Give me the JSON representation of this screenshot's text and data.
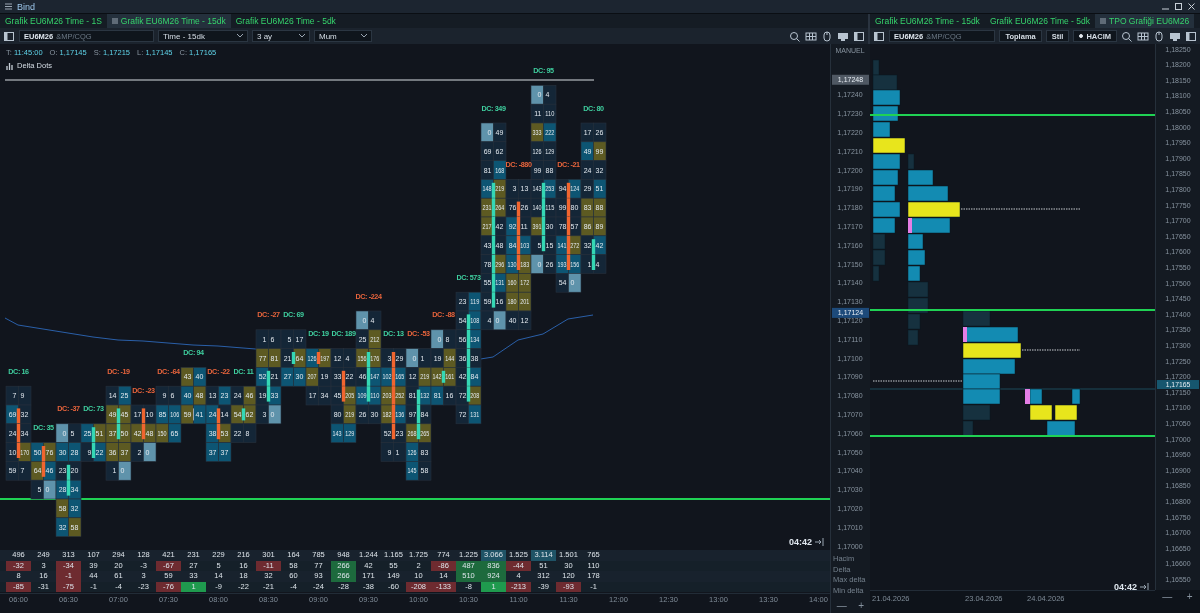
{
  "window": {
    "title": "Bind"
  },
  "left_panel": {
    "tabs": [
      {
        "label": "Grafik EU6M26 Time - 1S",
        "selected": false
      },
      {
        "label": "Grafik EU6M26 Time - 15dk",
        "selected": true
      },
      {
        "label": "Grafik EU6M26 Time - 5dk",
        "selected": false
      }
    ],
    "symbol": {
      "name": "EU6M26",
      "source": "&MP/CQG"
    },
    "dropdowns": [
      "Time - 15dk",
      "3 ay",
      "Mum"
    ],
    "ohlc": [
      {
        "label": "T:",
        "value": "11:45:00"
      },
      {
        "label": "O:",
        "value": "1,17145"
      },
      {
        "label": "S:",
        "value": "1,17215"
      },
      {
        "label": "L:",
        "value": "1,17145"
      },
      {
        "label": "C:",
        "value": "1,17165"
      }
    ],
    "indicator": "Delta Dots",
    "countdown": "04:42",
    "candles": [
      {
        "dc": "DC: 16",
        "color": "#3fcf9f",
        "kind": "down",
        "rows": [
          null,
          null,
          null,
          null,
          null,
          null,
          null,
          null,
          null,
          null,
          null,
          null,
          null,
          null,
          null,
          null,
          null,
          [
            "7",
            "9",
            false
          ],
          [
            "69",
            "32",
            true
          ],
          [
            "24",
            "34",
            true
          ],
          [
            "10",
            "170",
            true
          ],
          [
            "59",
            "7",
            false
          ]
        ]
      },
      {
        "dc": "DC: 35",
        "color": "#3fcf9f",
        "kind": "down",
        "rows": [
          null,
          null,
          null,
          null,
          null,
          null,
          null,
          null,
          null,
          null,
          null,
          null,
          null,
          null,
          null,
          null,
          null,
          null,
          null,
          null,
          [
            "50",
            "76",
            true
          ],
          [
            "64",
            "46",
            true
          ],
          [
            "5",
            "0",
            false
          ]
        ]
      },
      {
        "dc": "DC: -37",
        "color": "#e8643c",
        "kind": "up",
        "rows": [
          null,
          null,
          null,
          null,
          null,
          null,
          null,
          null,
          null,
          null,
          null,
          null,
          null,
          null,
          null,
          null,
          null,
          null,
          null,
          [
            "0",
            "5",
            false
          ],
          [
            "30",
            "28",
            false
          ],
          [
            "23",
            "20",
            true
          ],
          [
            "28",
            "34",
            true
          ],
          [
            "58",
            "32",
            false
          ],
          [
            "32",
            "58",
            false
          ]
        ]
      },
      {
        "dc": "DC: 73",
        "color": "#3fcf9f",
        "kind": "up",
        "rows": [
          null,
          null,
          null,
          null,
          null,
          null,
          null,
          null,
          null,
          null,
          null,
          null,
          null,
          null,
          null,
          null,
          null,
          null,
          null,
          [
            "25",
            "51",
            true
          ],
          [
            "9",
            "22",
            true
          ]
        ]
      },
      {
        "dc": "DC: -19",
        "color": "#e8643c",
        "kind": "up",
        "rows": [
          null,
          null,
          null,
          null,
          null,
          null,
          null,
          null,
          null,
          null,
          null,
          null,
          null,
          null,
          null,
          null,
          null,
          [
            "14",
            "25",
            false
          ],
          [
            "49",
            "45",
            true
          ],
          [
            "37",
            "50",
            true
          ],
          [
            "36",
            "37",
            false
          ],
          [
            "1",
            "0",
            false
          ]
        ]
      },
      {
        "dc": "DC: -23",
        "color": "#e8643c",
        "kind": "down",
        "rows": [
          null,
          null,
          null,
          null,
          null,
          null,
          null,
          null,
          null,
          null,
          null,
          null,
          null,
          null,
          null,
          null,
          null,
          null,
          [
            "17",
            "10",
            true
          ],
          [
            "42",
            "48",
            true
          ],
          [
            "2",
            "0",
            false
          ]
        ]
      },
      {
        "dc": "DC: -64",
        "color": "#e8643c",
        "rows": [
          null,
          null,
          null,
          null,
          null,
          null,
          null,
          null,
          null,
          null,
          null,
          null,
          null,
          null,
          null,
          null,
          null,
          [
            "9",
            "6",
            false
          ],
          [
            "85",
            "106",
            false
          ],
          [
            "150",
            "65",
            false
          ]
        ]
      },
      {
        "dc": "DC: 94",
        "color": "#3fcf9f",
        "kind": "doji",
        "rows": [
          null,
          null,
          null,
          null,
          null,
          null,
          null,
          null,
          null,
          null,
          null,
          null,
          null,
          null,
          null,
          null,
          [
            "43",
            "40",
            false
          ],
          [
            "40",
            "48",
            false
          ],
          [
            "59",
            "41",
            true
          ]
        ]
      },
      {
        "dc": "DC: -22",
        "color": "#e8643c",
        "kind": "down",
        "rows": [
          null,
          null,
          null,
          null,
          null,
          null,
          null,
          null,
          null,
          null,
          null,
          null,
          null,
          null,
          null,
          null,
          null,
          [
            "13",
            "23",
            false
          ],
          [
            "24",
            "14",
            true
          ],
          [
            "38",
            "53",
            true
          ],
          [
            "37",
            "37",
            false
          ]
        ]
      },
      {
        "dc": "DC: 11",
        "color": "#3fcf9f",
        "kind": "up",
        "rows": [
          null,
          null,
          null,
          null,
          null,
          null,
          null,
          null,
          null,
          null,
          null,
          null,
          null,
          null,
          null,
          null,
          null,
          [
            "24",
            "46",
            false
          ],
          [
            "54",
            "62",
            true
          ],
          [
            "22",
            "8",
            false
          ]
        ]
      },
      {
        "dc": "DC: -27",
        "color": "#e8643c",
        "kind": "up",
        "rows": [
          null,
          null,
          null,
          null,
          null,
          null,
          null,
          null,
          null,
          null,
          null,
          null,
          null,
          null,
          [
            "1",
            "6",
            false
          ],
          [
            "77",
            "81",
            false
          ],
          [
            "52",
            "21",
            true
          ],
          [
            "19",
            "33",
            true
          ],
          [
            "3",
            "0",
            false
          ]
        ]
      },
      {
        "dc": "DC: 69",
        "color": "#3fcf9f",
        "kind": "up",
        "rows": [
          null,
          null,
          null,
          null,
          null,
          null,
          null,
          null,
          null,
          null,
          null,
          null,
          null,
          null,
          [
            "5",
            "17",
            false
          ],
          [
            "21",
            "64",
            true
          ],
          [
            "27",
            "30",
            false
          ]
        ]
      },
      {
        "dc": "DC: 19",
        "color": "#3fcf9f",
        "kind": "down",
        "rows": [
          null,
          null,
          null,
          null,
          null,
          null,
          null,
          null,
          null,
          null,
          null,
          null,
          null,
          null,
          null,
          [
            "126",
            "197",
            true
          ],
          [
            "207",
            "19",
            false
          ],
          [
            "17",
            "34",
            false
          ]
        ]
      },
      {
        "dc": "DC: 189",
        "color": "#3fcf9f",
        "kind": "down",
        "rows": [
          null,
          null,
          null,
          null,
          null,
          null,
          null,
          null,
          null,
          null,
          null,
          null,
          null,
          null,
          null,
          [
            "12",
            "4",
            false
          ],
          [
            "33",
            "22",
            true
          ],
          [
            "45",
            "205",
            true
          ],
          [
            "80",
            "219",
            false
          ],
          [
            "143",
            "129",
            false
          ]
        ]
      },
      {
        "dc": "DC: -224",
        "color": "#e8643c",
        "kind": "up",
        "rows": [
          null,
          null,
          null,
          null,
          null,
          null,
          null,
          null,
          null,
          null,
          null,
          null,
          null,
          [
            "0",
            "4",
            false
          ],
          [
            "25",
            "212",
            false
          ],
          [
            "156",
            "176",
            true
          ],
          [
            "46",
            "147",
            true
          ],
          [
            "109",
            "110",
            true
          ],
          [
            "26",
            "30",
            false
          ]
        ]
      },
      {
        "dc": "DC: 13",
        "color": "#3fcf9f",
        "kind": "down",
        "rows": [
          null,
          null,
          null,
          null,
          null,
          null,
          null,
          null,
          null,
          null,
          null,
          null,
          null,
          null,
          null,
          [
            "3",
            "29",
            true
          ],
          [
            "102",
            "165",
            true
          ],
          [
            "203",
            "252",
            true
          ],
          [
            "182",
            "136",
            true
          ],
          [
            "52",
            "23",
            true
          ],
          [
            "9",
            "1",
            false
          ]
        ]
      },
      {
        "dc": "DC: -53",
        "color": "#e8643c",
        "kind": "up",
        "rows": [
          null,
          null,
          null,
          null,
          null,
          null,
          null,
          null,
          null,
          null,
          null,
          null,
          null,
          null,
          null,
          [
            "0",
            "1",
            false
          ],
          [
            "12",
            "219",
            false
          ],
          [
            "81",
            "132",
            true
          ],
          [
            "97",
            "84",
            true
          ],
          [
            "268",
            "265",
            true
          ],
          [
            "126",
            "83",
            false
          ],
          [
            "145",
            "58",
            false
          ]
        ]
      },
      {
        "dc": "DC: -88",
        "color": "#e8643c",
        "kind": "up",
        "rows": [
          null,
          null,
          null,
          null,
          null,
          null,
          null,
          null,
          null,
          null,
          null,
          null,
          null,
          null,
          [
            "0",
            "8",
            false
          ],
          [
            "19",
            "144",
            false
          ],
          [
            "142",
            "161",
            true
          ],
          [
            "81",
            "16",
            false
          ]
        ]
      },
      {
        "dc": "DC: 573",
        "color": "#3fcf9f",
        "kind": "up",
        "rows": [
          null,
          null,
          null,
          null,
          null,
          null,
          null,
          null,
          null,
          null,
          null,
          null,
          [
            "23",
            "119",
            false
          ],
          [
            "54",
            "108",
            true
          ],
          [
            "56",
            "134",
            true
          ],
          [
            "36",
            "38",
            true
          ],
          [
            "42",
            "84",
            true
          ],
          [
            "72",
            "208",
            true
          ],
          [
            "72",
            "131",
            false
          ]
        ]
      },
      {
        "dc": "DC: 349",
        "color": "#3fcf9f",
        "kind": "up",
        "rows": [
          null,
          null,
          null,
          [
            "0",
            "49",
            false
          ],
          [
            "69",
            "62",
            false
          ],
          [
            "81",
            "168",
            false
          ],
          [
            "148",
            "219",
            true
          ],
          [
            "231",
            "264",
            true
          ],
          [
            "217",
            "42",
            true
          ],
          [
            "43",
            "48",
            true
          ],
          [
            "78",
            "296",
            true
          ],
          [
            "55",
            "131",
            true
          ],
          [
            "59",
            "16",
            true
          ],
          [
            "4",
            "0",
            false
          ]
        ]
      },
      {
        "dc": "DC: -880",
        "color": "#e8643c",
        "kind": "down",
        "rows": [
          null,
          null,
          null,
          null,
          null,
          null,
          [
            "3",
            "13",
            false
          ],
          [
            "76",
            "26",
            true
          ],
          [
            "92",
            "11",
            true
          ],
          [
            "84",
            "103",
            true
          ],
          [
            "130",
            "183",
            true
          ],
          [
            "160",
            "172",
            false
          ],
          [
            "180",
            "201",
            false
          ],
          [
            "40",
            "12",
            false
          ]
        ]
      },
      {
        "dc": "DC: 95",
        "color": "#3fcf9f",
        "kind": "up",
        "rows": [
          null,
          [
            "0",
            "4",
            false
          ],
          [
            "11",
            "110",
            false
          ],
          [
            "333",
            "222",
            false
          ],
          [
            "126",
            "129",
            false
          ],
          [
            "99",
            "88",
            false
          ],
          [
            "143",
            "253",
            true
          ],
          [
            "140",
            "115",
            true
          ],
          [
            "391",
            "30",
            true
          ],
          [
            "5",
            "15",
            true
          ],
          [
            "0",
            "26",
            false
          ]
        ]
      },
      {
        "dc": "DC: -21",
        "color": "#e8643c",
        "kind": "down",
        "rows": [
          null,
          null,
          null,
          null,
          null,
          null,
          [
            "94",
            "124",
            true
          ],
          [
            "99",
            "80",
            true
          ],
          [
            "78",
            "57",
            true
          ],
          [
            "141",
            "272",
            true
          ],
          [
            "193",
            "156",
            true
          ],
          [
            "54",
            "0",
            false
          ]
        ]
      },
      {
        "dc": "DC: 80",
        "color": "#3fcf9f",
        "kind": "up",
        "rows": [
          null,
          null,
          null,
          [
            "17",
            "26",
            false
          ],
          [
            "49",
            "99",
            false
          ],
          [
            "24",
            "32",
            false
          ],
          [
            "29",
            "51",
            false
          ],
          [
            "83",
            "88",
            false
          ],
          [
            "86",
            "89",
            false
          ],
          [
            "32",
            "42",
            true
          ],
          [
            "1",
            "4",
            true
          ]
        ]
      }
    ],
    "price_axis": {
      "mode": "MANUEL",
      "labels": [
        "1,17240",
        "1,17230",
        "1,17220",
        "1,17210",
        "1,17200",
        "1,17190",
        "1,17180",
        "1,17170",
        "1,17160",
        "1,17150",
        "1,17140",
        "1,17130",
        "1,17120",
        "1,17110",
        "1,17100",
        "1,17090",
        "1,17080",
        "1,17070",
        "1,17060",
        "1,17050",
        "1,17040",
        "1,17030",
        "1,17020",
        "1,17010",
        "1,17000"
      ],
      "markers": [
        {
          "text": "1,17248",
          "kind": "high"
        },
        {
          "text": "1,17124",
          "kind": "vwap"
        }
      ]
    },
    "stats": {
      "row_labels": [
        "Hacim",
        "Delta",
        "Max delta",
        "Min delta"
      ],
      "rows": [
        [
          "496",
          "249",
          "313",
          "107",
          "294",
          "128",
          "421",
          "231",
          "229",
          "216",
          "301",
          "164",
          "785",
          "948",
          "1.244",
          "1.165",
          "1.725",
          "774",
          "1.225",
          {
            "text": "3.066",
            "kind": "hi"
          },
          "1.525",
          {
            "text": "3.114",
            "kind": "hi"
          },
          "1.501",
          "765"
        ],
        [
          {
            "text": "-32",
            "kind": "neg"
          },
          "3",
          {
            "text": "-34",
            "kind": "neg"
          },
          "39",
          "20",
          "-3",
          {
            "text": "-67",
            "kind": "neg"
          },
          "27",
          "5",
          "16",
          {
            "text": "-11",
            "kind": "neg"
          },
          "58",
          "77",
          {
            "text": "266",
            "kind": "pos"
          },
          "42",
          "55",
          "2",
          {
            "text": "-86",
            "kind": "neg"
          },
          {
            "text": "487",
            "kind": "pos"
          },
          {
            "text": "836",
            "kind": "pos"
          },
          {
            "text": "-44",
            "kind": "neg"
          },
          "51",
          "30",
          "110"
        ],
        [
          "8",
          "16",
          {
            "text": "-1",
            "kind": "neg"
          },
          "44",
          "61",
          "3",
          "59",
          "33",
          "14",
          "18",
          "32",
          "60",
          "93",
          {
            "text": "266",
            "kind": "pos"
          },
          "171",
          "149",
          "10",
          "14",
          {
            "text": "510",
            "kind": "pos"
          },
          {
            "text": "924",
            "kind": "pos"
          },
          "4",
          "312",
          "120",
          "178"
        ],
        [
          {
            "text": "-85",
            "kind": "neg"
          },
          "-31",
          {
            "text": "-75",
            "kind": "neg"
          },
          "-1",
          "-4",
          "-23",
          {
            "text": "-76",
            "kind": "neg"
          },
          {
            "text": "1",
            "kind": "bright"
          },
          "-9",
          "-22",
          "-21",
          "-4",
          "-24",
          "-28",
          "-38",
          "-60",
          {
            "text": "-208",
            "kind": "neg"
          },
          {
            "text": "-133",
            "kind": "neg"
          },
          "-8",
          {
            "text": "1",
            "kind": "bright"
          },
          {
            "text": "-213",
            "kind": "neg"
          },
          "-39",
          {
            "text": "-93",
            "kind": "neg"
          },
          "-1"
        ]
      ]
    },
    "time_axis": [
      "06:00",
      "06:30",
      "07:00",
      "07:30",
      "08:00",
      "08:30",
      "09:00",
      "09:30",
      "10:00",
      "10:30",
      "11:00",
      "11:30",
      "12:00",
      "12:30",
      "13:00",
      "13:30",
      "14:00"
    ],
    "zoom_controls": [
      "—",
      "+"
    ]
  },
  "right_panel": {
    "tabs": [
      {
        "label": "Grafik EU6M26 Time - 15dk",
        "selected": false
      },
      {
        "label": "Grafik EU6M26 Time - 5dk",
        "selected": false
      },
      {
        "label": "TPO Grafiği EU6M26",
        "selected": true
      }
    ],
    "symbol": {
      "name": "EU6M26",
      "source": "&MP/CQG"
    },
    "buttons": [
      "Toplama",
      "Stil"
    ],
    "toggle": {
      "label": "HACIM",
      "on": true
    },
    "price_axis": {
      "labels": [
        "1,18250",
        "1,18200",
        "1,18150",
        "1,18100",
        "1,18050",
        "1,18000",
        "1,17950",
        "1,17900",
        "1,17850",
        "1,17800",
        "1,17750",
        "1,17700",
        "1,17650",
        "1,17600",
        "1,17550",
        "1,17500",
        "1,17450",
        "1,17400",
        "1,17350",
        "1,17300",
        "1,17250",
        "1,17200",
        "1,17150",
        "1,17100",
        "1,17050",
        "1,17000",
        "1,16950",
        "1,16900",
        "1,16850",
        "1,16800",
        "1,16750",
        "1,16700",
        "1,16650",
        "1,16600",
        "1,16550"
      ],
      "markers": [
        {
          "text": "1,17165",
          "kind": "last"
        }
      ]
    },
    "dates": [
      "21.04.2026",
      "23.04.2026",
      "24.04.2026"
    ],
    "countdown": "04:42",
    "zoom_controls": [
      "—",
      "+"
    ]
  }
}
